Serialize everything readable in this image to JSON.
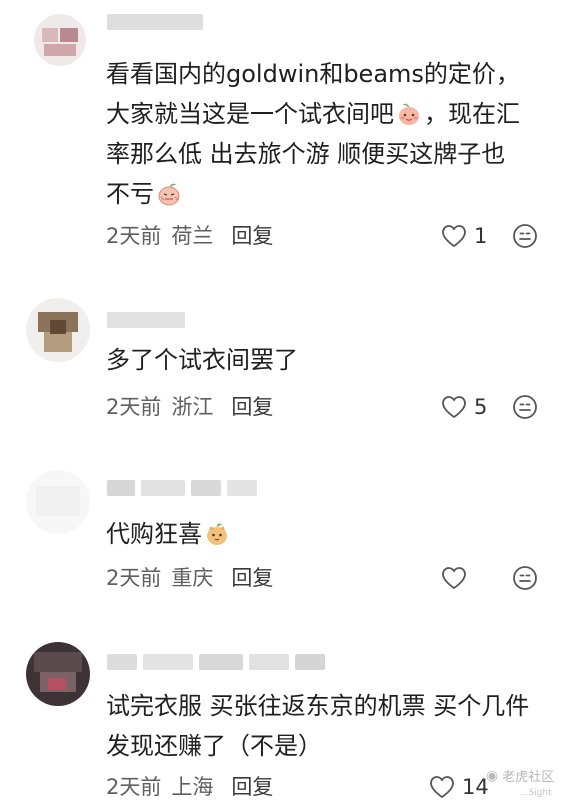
{
  "comments": [
    {
      "text_parts": [
        "看看国内的goldwin和beams的定价，",
        "大家就当这是一个试衣间吧",
        "，现在汇",
        "率那么低 出去旅个游 顺便买这牌子也",
        "不亏",
        ""
      ],
      "time": "2天前",
      "location": "荷兰",
      "reply": "回复",
      "likes": "1"
    },
    {
      "text": "多了个试衣间罢了",
      "time": "2天前",
      "location": "浙江",
      "reply": "回复",
      "likes": "5"
    },
    {
      "text": "代购狂喜",
      "time": "2天前",
      "location": "重庆",
      "reply": "回复",
      "likes": ""
    },
    {
      "text_parts": [
        "试完衣服 买张往返东京的机票 买个几件",
        "发现还赚了（不是）"
      ],
      "time": "2天前",
      "location": "上海",
      "reply": "回复",
      "likes": "14"
    }
  ],
  "icons": {
    "like": "heart-outline-icon",
    "react": "smiley-icon",
    "emoji_1": "peach-smile-emoji",
    "emoji_2": "peach-shy-emoji",
    "emoji_3": "cat-peach-emoji"
  },
  "watermark": {
    "text": "老虎社区",
    "sub": "...Sight"
  },
  "colors": {
    "text": "#1f1f1f",
    "meta": "#5f5f5f",
    "icon": "#555555"
  }
}
